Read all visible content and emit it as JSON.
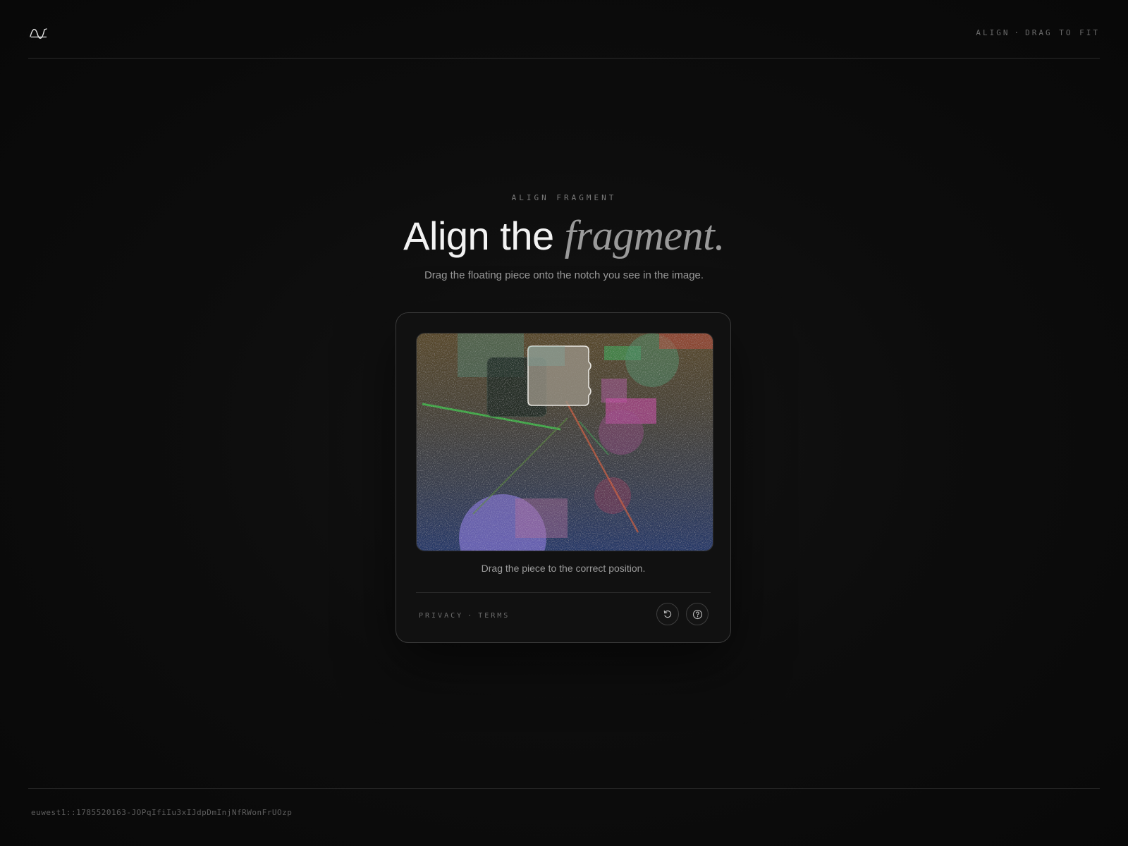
{
  "header": {
    "logo_icon": "wave-logo-icon",
    "tagline_left": "ALIGN",
    "tagline_sep": "·",
    "tagline_right": "DRAG TO FIT"
  },
  "hero": {
    "eyebrow": "ALIGN FRAGMENT",
    "title_plain": "Align the ",
    "title_accent": "fragment.",
    "subtitle": "Drag the floating piece onto the notch you see in the image."
  },
  "challenge": {
    "status": "Drag the piece to the correct position.",
    "privacy_label": "PRIVACY",
    "link_sep": "·",
    "terms_label": "TERMS",
    "refresh_icon": "refresh-icon",
    "help_icon": "help-icon"
  },
  "footer": {
    "session_id": "euwest1::1785520163-JOPqIfiIu3xIJdpDmInjNfRWonFrUOzp"
  },
  "colors": {
    "background": "#0b0b0b",
    "card": "#111111",
    "text_primary": "#f2f2f2",
    "text_muted": "#9a9a9a"
  }
}
